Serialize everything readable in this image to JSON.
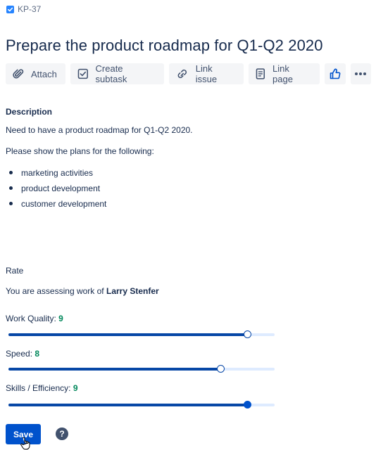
{
  "issue": {
    "key": "KP-37",
    "title": "Prepare the product roadmap for Q1-Q2 2020"
  },
  "toolbar": {
    "attach": "Attach",
    "create_subtask": "Create subtask",
    "link_issue": "Link issue",
    "link_page": "Link page"
  },
  "description": {
    "heading": "Description",
    "line1": "Need to have a product roadmap for Q1-Q2 2020.",
    "line2": "Please show the plans for the following:",
    "items": [
      "marketing activities",
      "product development",
      "customer development"
    ]
  },
  "rate": {
    "heading": "Rate",
    "assess_prefix": "You are assessing work of",
    "assessee": "Larry Stenfer",
    "max_score": 10,
    "criteria": [
      {
        "label": "Work Quality:",
        "score": 9,
        "level": 0.9
      },
      {
        "label": "Speed:",
        "score": 8,
        "level": 0.8
      },
      {
        "label": "Skills / Efficiency:",
        "score": 9,
        "level": 0.9
      }
    ]
  },
  "actions": {
    "save": "Save",
    "help": "?"
  },
  "colors": {
    "accent": "#0052cc",
    "track": "#deebff",
    "fill": "#0747a6",
    "score": "#00875a"
  }
}
